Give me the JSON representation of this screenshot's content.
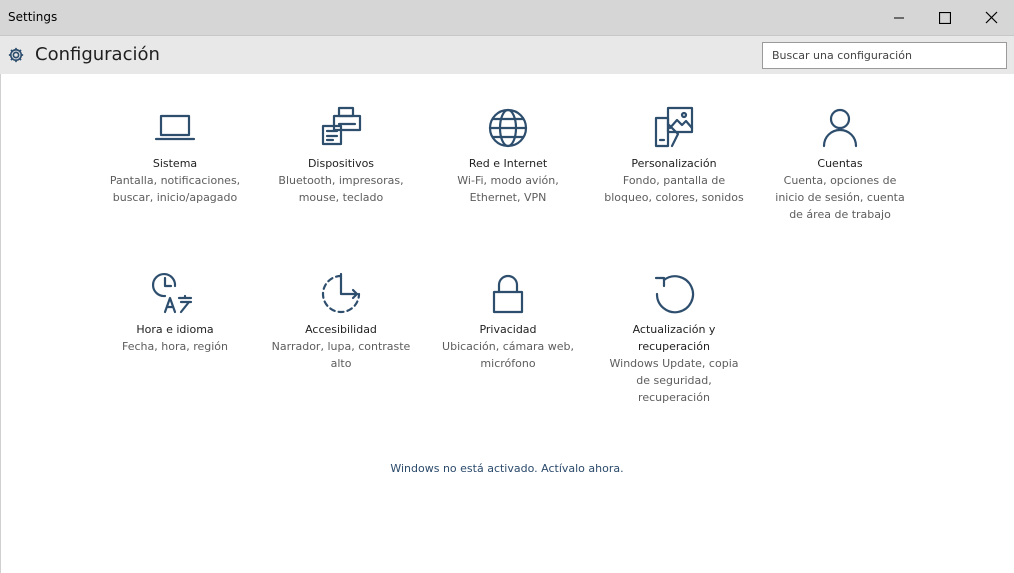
{
  "window": {
    "title": "Settings",
    "controls": [
      "minimize",
      "maximize",
      "close"
    ]
  },
  "header": {
    "title": "Configuración",
    "search_placeholder": "Buscar una configuración"
  },
  "categories": [
    {
      "name": "Sistema",
      "desc": "Pantalla, notificaciones, buscar, inicio/apagado",
      "icon": "laptop-icon"
    },
    {
      "name": "Dispositivos",
      "desc": "Bluetooth, impresoras, mouse, teclado",
      "icon": "devices-icon"
    },
    {
      "name": "Red e Internet",
      "desc": "Wi-Fi, modo avión, Ethernet, VPN",
      "icon": "globe-icon"
    },
    {
      "name": "Personalización",
      "desc": "Fondo, pantalla de bloqueo, colores, sonidos",
      "icon": "personalization-icon"
    },
    {
      "name": "Cuentas",
      "desc": "Cuenta, opciones de inicio de sesión, cuenta de área de trabajo",
      "icon": "person-icon"
    },
    {
      "name": "Hora e idioma",
      "desc": "Fecha, hora, región",
      "icon": "time-language-icon"
    },
    {
      "name": "Accesibilidad",
      "desc": "Narrador, lupa, contraste alto",
      "icon": "ease-of-access-icon"
    },
    {
      "name": "Privacidad",
      "desc": "Ubicación, cámara web, micrófono",
      "icon": "lock-icon"
    },
    {
      "name": "Actualización y recuperación",
      "desc": "Windows Update, copia de seguridad, recuperación",
      "icon": "update-icon"
    }
  ],
  "activation_notice": "Windows no está activado. Actívalo ahora.",
  "colors": {
    "icon": "#2e4e6e",
    "titlebar": "#d6d6d6",
    "header": "#e8e8e8",
    "link": "#2b4a6b"
  }
}
